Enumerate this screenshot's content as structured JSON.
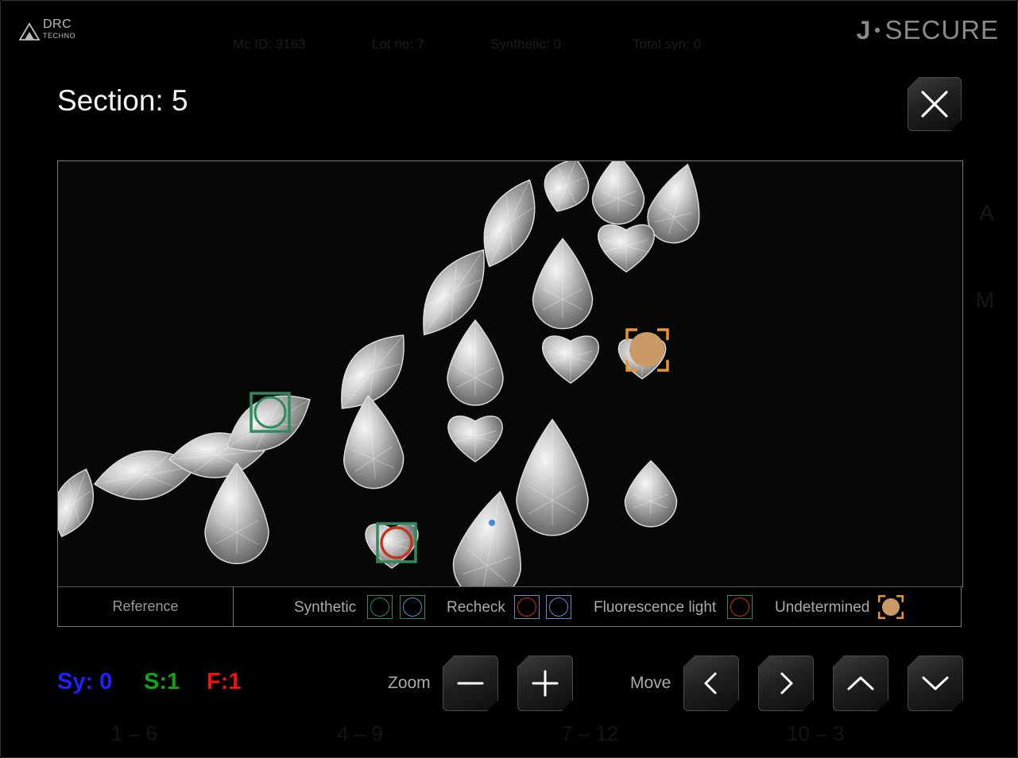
{
  "background": {
    "stats": [
      "Mc ID: 3163",
      "Lot no: 7",
      "Synthetic: 0",
      "Total syn: 0"
    ],
    "ranges": [
      "1 – 6",
      "4 – 9",
      "7 – 12",
      "10 – 3"
    ],
    "side_letters": [
      "A",
      "M"
    ]
  },
  "logo": {
    "top": "DRC",
    "bottom": "TECHNO"
  },
  "brand": {
    "j": "J",
    "name": "SECURE"
  },
  "dialog": {
    "title": "Section: 5",
    "close_icon": "close-icon"
  },
  "legend": {
    "reference": "Reference",
    "synthetic": "Synthetic",
    "recheck": "Recheck",
    "fluorescence": "Fluorescence light",
    "undetermined": "Undetermined"
  },
  "colors": {
    "green": "#2e8b60",
    "blue": "#5b8fc9",
    "red": "#c4341c",
    "orange": "#e8962c",
    "tan": "#c99a66",
    "count_sy": "#1f1fff",
    "count_s": "#13a313",
    "count_f": "#ee1111"
  },
  "counts": {
    "sy": "Sy: 0",
    "s": "S:1",
    "f": "F:1"
  },
  "controls": {
    "zoom_label": "Zoom",
    "move_label": "Move",
    "zoom_out_icon": "minus-icon",
    "zoom_in_icon": "plus-icon",
    "left_icon": "chevron-left-icon",
    "right_icon": "chevron-right-icon",
    "up_icon": "chevron-up-icon",
    "down_icon": "chevron-down-icon"
  }
}
